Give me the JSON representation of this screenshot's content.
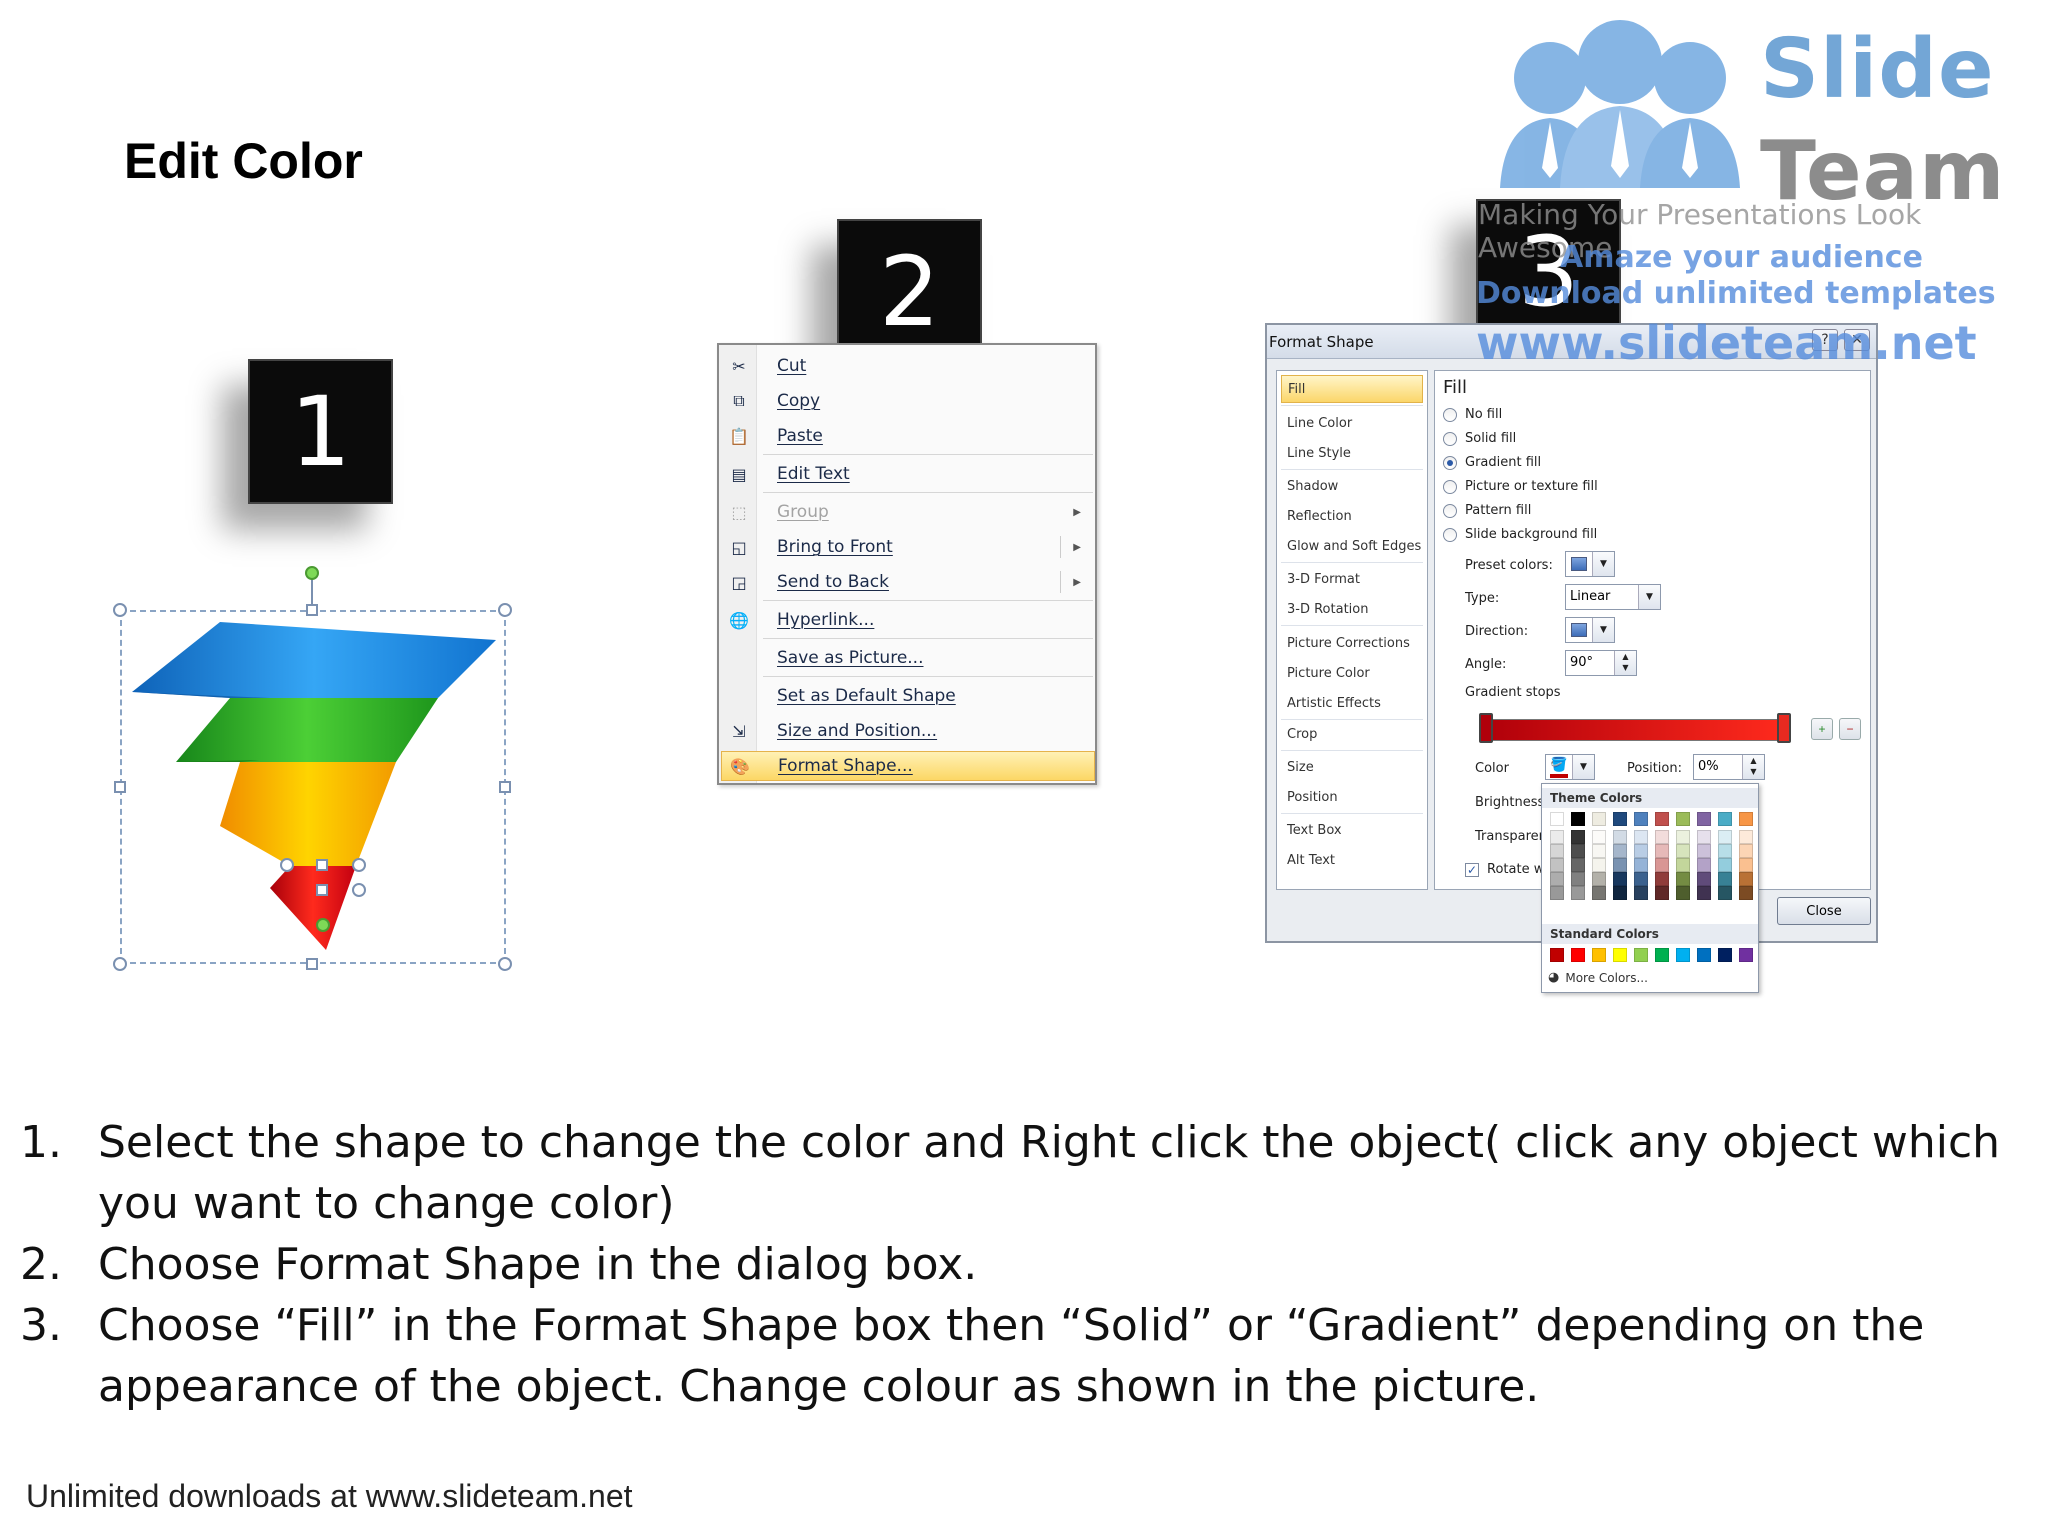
{
  "slide": {
    "title": "Edit Color",
    "footer": "Unlimited downloads at www.slideteam.net"
  },
  "steps": {
    "step1": "1",
    "step2": "2",
    "step3": "3"
  },
  "pyramid": {
    "layer_colors": [
      "#1f86e0",
      "#2fb52a",
      "#ffb400",
      "#e0201b"
    ]
  },
  "context_menu": {
    "items": [
      {
        "label": "Cut",
        "icon": "scissors-icon",
        "disabled": false,
        "submenu": false
      },
      {
        "label": "Copy",
        "icon": "copy-icon",
        "disabled": false,
        "submenu": false
      },
      {
        "label": "Paste",
        "icon": "paste-icon",
        "disabled": false,
        "submenu": false
      },
      {
        "label": "Edit Text",
        "icon": "edit-text-icon",
        "disabled": false,
        "submenu": false
      },
      {
        "label": "Group",
        "icon": "group-icon",
        "disabled": true,
        "submenu": true
      },
      {
        "label": "Bring to Front",
        "icon": "bring-front-icon",
        "disabled": false,
        "submenu": true
      },
      {
        "label": "Send to Back",
        "icon": "send-back-icon",
        "disabled": false,
        "submenu": true
      },
      {
        "label": "Hyperlink...",
        "icon": "hyperlink-icon",
        "disabled": false,
        "submenu": false
      },
      {
        "label": "Save as Picture...",
        "icon": "",
        "disabled": false,
        "submenu": false
      },
      {
        "label": "Set as Default Shape",
        "icon": "",
        "disabled": false,
        "submenu": false
      },
      {
        "label": "Size and Position...",
        "icon": "size-position-icon",
        "disabled": false,
        "submenu": false
      },
      {
        "label": "Format Shape...",
        "icon": "format-shape-icon",
        "disabled": false,
        "submenu": false,
        "highlighted": true
      }
    ]
  },
  "format_dialog": {
    "title": "Format Shape",
    "help_label": "?",
    "close_x_label": "✕",
    "nav": [
      "Fill",
      "Line Color",
      "Line Style",
      "Shadow",
      "Reflection",
      "Glow and Soft Edges",
      "3-D Format",
      "3-D Rotation",
      "Picture Corrections",
      "Picture Color",
      "Artistic Effects",
      "Crop",
      "Size",
      "Position",
      "Text Box",
      "Alt Text"
    ],
    "pane_title": "Fill",
    "fill_options": [
      "No fill",
      "Solid fill",
      "Gradient fill",
      "Picture or texture fill",
      "Pattern fill",
      "Slide background fill"
    ],
    "selected_fill": "Gradient fill",
    "preset_colors_label": "Preset colors:",
    "type_label": "Type:",
    "type_value": "Linear",
    "direction_label": "Direction:",
    "angle_label": "Angle:",
    "angle_value": "90°",
    "gradient_stops_label": "Gradient stops",
    "color_label": "Color",
    "position_label": "Position:",
    "position_value": "0%",
    "brightness_label": "Brightness",
    "transparency_label": "Transparen",
    "rotate_label": "Rotate w",
    "close_label": "Close"
  },
  "color_popup": {
    "theme_header": "Theme Colors",
    "standard_header": "Standard Colors",
    "more_colors": "More Colors...",
    "theme_base": [
      "#ffffff",
      "#000000",
      "#eeece1",
      "#1f497d",
      "#4f81bd",
      "#c0504d",
      "#9bbb59",
      "#8064a2",
      "#4bacc6",
      "#f79646"
    ],
    "standard": [
      "#c00000",
      "#ff0000",
      "#ffc000",
      "#ffff00",
      "#92d050",
      "#00b050",
      "#00b0f0",
      "#0070c0",
      "#002060",
      "#7030a0"
    ]
  },
  "watermark": {
    "brand_line1": "Slide",
    "brand_line2": "Team",
    "tagline": "Making Your Presentations Look Awesome",
    "promo1": "Amaze your audience",
    "promo2": "Download unlimited templates",
    "promo3": "www.slideteam.net"
  },
  "instructions": [
    {
      "num": "1.",
      "text": "Select the shape to change the color and Right click the object( click any object which you want to change color)"
    },
    {
      "num": "2.",
      "text": "Choose Format Shape in the dialog box."
    },
    {
      "num": "3.",
      "text": "Choose “Fill” in the Format Shape box then “Solid” or “Gradient” depending on the appearance of the object. Change colour as shown in the picture."
    }
  ]
}
